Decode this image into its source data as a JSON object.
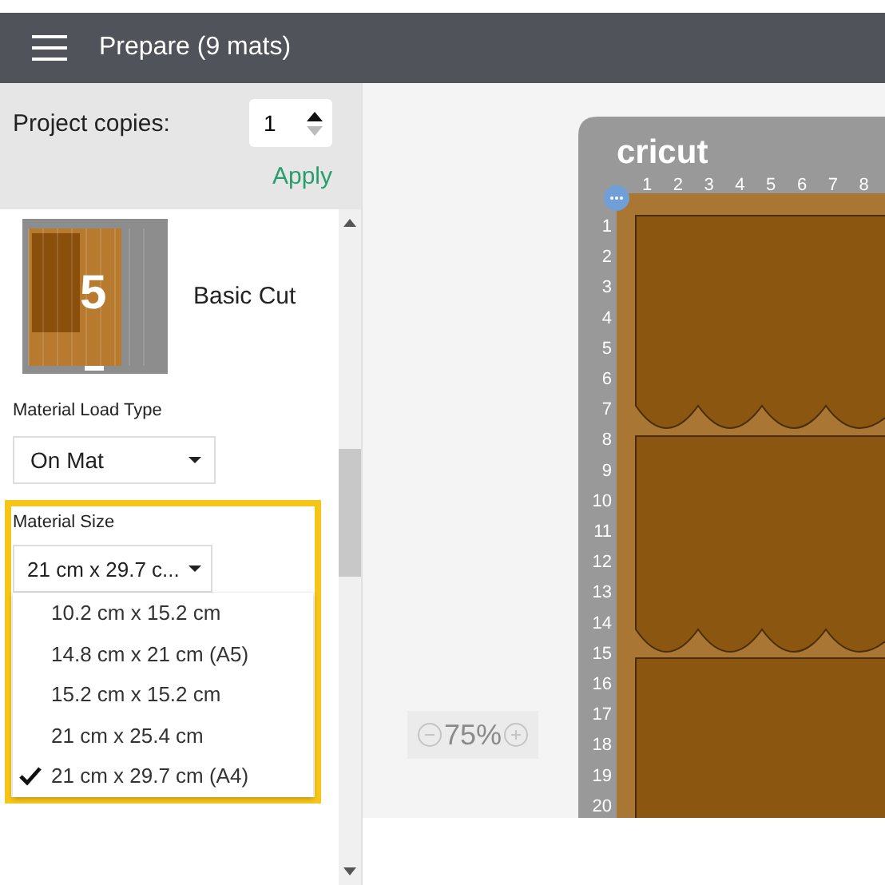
{
  "header": {
    "title": "Prepare (9 mats)"
  },
  "copies": {
    "label": "Project copies:",
    "value": "1",
    "increment_disabled": false,
    "decrement_disabled": true,
    "apply": "Apply"
  },
  "mat": {
    "number": "5",
    "name": "Basic Cut"
  },
  "load_type": {
    "label": "Material Load Type",
    "value": "On Mat"
  },
  "material_size": {
    "label": "Material Size",
    "value": "21 cm x 29.7 c...",
    "highlighted": true,
    "expanded": true,
    "options": [
      {
        "label": "10.2 cm x 15.2 cm",
        "selected": false
      },
      {
        "label": "14.8 cm x 21 cm (A5)",
        "selected": false
      },
      {
        "label": "15.2 cm x 15.2 cm",
        "selected": false
      },
      {
        "label": "21 cm x 25.4 cm",
        "selected": false
      },
      {
        "label": "21 cm x 29.7 cm (A4)",
        "selected": true
      }
    ]
  },
  "zoom": {
    "value": "75%"
  },
  "canvas_mat": {
    "logo": "cricut",
    "x_ruler": [
      "1",
      "2",
      "3",
      "4",
      "5",
      "6",
      "7",
      "8"
    ],
    "y_ruler": [
      "1",
      "2",
      "3",
      "4",
      "5",
      "6",
      "7",
      "8",
      "9",
      "10",
      "11",
      "12",
      "13",
      "14",
      "15",
      "16",
      "17",
      "18",
      "19",
      "20"
    ]
  }
}
